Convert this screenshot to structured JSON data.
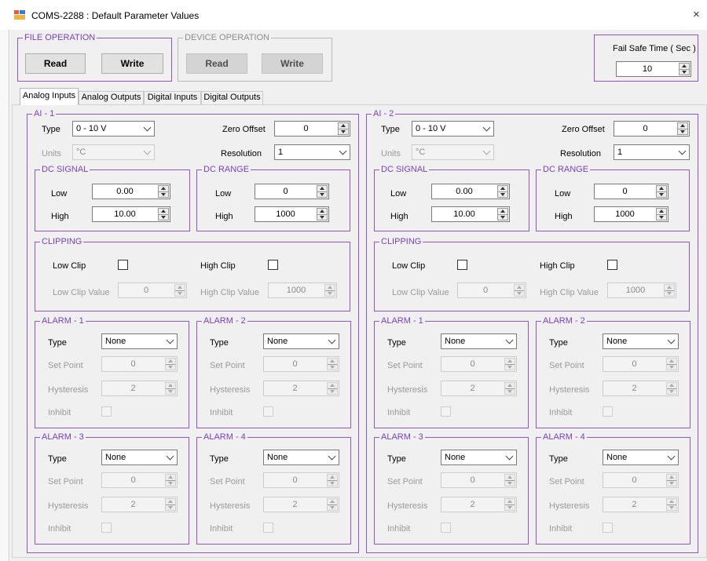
{
  "window": {
    "title": "COMS-2288 : Default Parameter Values",
    "close_glyph": "×"
  },
  "file_operation": {
    "legend": "FILE OPERATION",
    "read_label": "Read",
    "write_label": "Write"
  },
  "device_operation": {
    "legend": "DEVICE OPERATION",
    "read_label": "Read",
    "write_label": "Write"
  },
  "fail_safe": {
    "label": "Fail Safe Time ( Sec )",
    "value": "10"
  },
  "tabs": [
    {
      "label": "Analog Inputs"
    },
    {
      "label": "Analog Outputs"
    },
    {
      "label": "Digital Inputs"
    },
    {
      "label": "Digital Outputs"
    }
  ],
  "channels": [
    {
      "legend": "AI - 1",
      "type_label": "Type",
      "type_value": "0 - 10 V",
      "units_label": "Units",
      "units_value": "°C",
      "zero_offset_label": "Zero Offset",
      "zero_offset_value": "0",
      "resolution_label": "Resolution",
      "resolution_value": "1",
      "dc_signal": {
        "legend": "DC SIGNAL",
        "low_label": "Low",
        "low_value": "0.00",
        "high_label": "High",
        "high_value": "10.00"
      },
      "dc_range": {
        "legend": "DC RANGE",
        "low_label": "Low",
        "low_value": "0",
        "high_label": "High",
        "high_value": "1000"
      },
      "clipping": {
        "legend": "CLIPPING",
        "low_clip_label": "Low Clip",
        "high_clip_label": "High Clip",
        "low_clip_value_label": "Low Clip Value",
        "low_clip_value": "0",
        "high_clip_value_label": "High Clip Value",
        "high_clip_value": "1000"
      },
      "alarms": [
        {
          "legend": "ALARM - 1",
          "type_label": "Type",
          "type_value": "None",
          "set_point_label": "Set Point",
          "set_point_value": "0",
          "hysteresis_label": "Hysteresis",
          "hysteresis_value": "2",
          "inhibit_label": "Inhibit"
        },
        {
          "legend": "ALARM - 2",
          "type_label": "Type",
          "type_value": "None",
          "set_point_label": "Set Point",
          "set_point_value": "0",
          "hysteresis_label": "Hysteresis",
          "hysteresis_value": "2",
          "inhibit_label": "Inhibit"
        },
        {
          "legend": "ALARM - 3",
          "type_label": "Type",
          "type_value": "None",
          "set_point_label": "Set Point",
          "set_point_value": "0",
          "hysteresis_label": "Hysteresis",
          "hysteresis_value": "2",
          "inhibit_label": "Inhibit"
        },
        {
          "legend": "ALARM - 4",
          "type_label": "Type",
          "type_value": "None",
          "set_point_label": "Set Point",
          "set_point_value": "0",
          "hysteresis_label": "Hysteresis",
          "hysteresis_value": "2",
          "inhibit_label": "Inhibit"
        }
      ]
    },
    {
      "legend": "AI - 2",
      "type_label": "Type",
      "type_value": "0 - 10 V",
      "units_label": "Units",
      "units_value": "°C",
      "zero_offset_label": "Zero Offset",
      "zero_offset_value": "0",
      "resolution_label": "Resolution",
      "resolution_value": "1",
      "dc_signal": {
        "legend": "DC SIGNAL",
        "low_label": "Low",
        "low_value": "0.00",
        "high_label": "High",
        "high_value": "10.00"
      },
      "dc_range": {
        "legend": "DC RANGE",
        "low_label": "Low",
        "low_value": "0",
        "high_label": "High",
        "high_value": "1000"
      },
      "clipping": {
        "legend": "CLIPPING",
        "low_clip_label": "Low Clip",
        "high_clip_label": "High Clip",
        "low_clip_value_label": "Low Clip Value",
        "low_clip_value": "0",
        "high_clip_value_label": "High Clip Value",
        "high_clip_value": "1000"
      },
      "alarms": [
        {
          "legend": "ALARM - 1",
          "type_label": "Type",
          "type_value": "None",
          "set_point_label": "Set Point",
          "set_point_value": "0",
          "hysteresis_label": "Hysteresis",
          "hysteresis_value": "2",
          "inhibit_label": "Inhibit"
        },
        {
          "legend": "ALARM - 2",
          "type_label": "Type",
          "type_value": "None",
          "set_point_label": "Set Point",
          "set_point_value": "0",
          "hysteresis_label": "Hysteresis",
          "hysteresis_value": "2",
          "inhibit_label": "Inhibit"
        },
        {
          "legend": "ALARM - 3",
          "type_label": "Type",
          "type_value": "None",
          "set_point_label": "Set Point",
          "set_point_value": "0",
          "hysteresis_label": "Hysteresis",
          "hysteresis_value": "2",
          "inhibit_label": "Inhibit"
        },
        {
          "legend": "ALARM - 4",
          "type_label": "Type",
          "type_value": "None",
          "set_point_label": "Set Point",
          "set_point_value": "0",
          "hysteresis_label": "Hysteresis",
          "hysteresis_value": "2",
          "inhibit_label": "Inhibit"
        }
      ]
    }
  ],
  "colors": {
    "group_border": "#8f55c9",
    "legend_text": "#7a3fc0",
    "form_bg": "#f0f0f0"
  }
}
